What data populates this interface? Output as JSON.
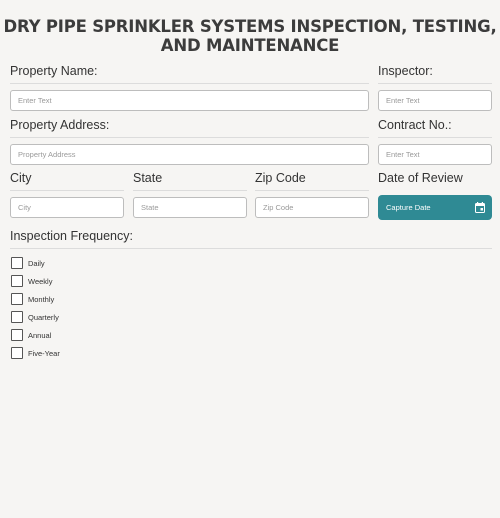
{
  "title": "DRY PIPE SPRINKLER SYSTEMS INSPECTION, TESTING, AND MAINTENANCE",
  "fields": {
    "property_name": {
      "label": "Property Name:",
      "placeholder": "Enter Text"
    },
    "inspector": {
      "label": "Inspector:",
      "placeholder": "Enter Text"
    },
    "property_address": {
      "label": "Property Address:",
      "placeholder": "Property Address"
    },
    "contract_no": {
      "label": "Contract No.:",
      "placeholder": "Enter Text"
    },
    "city": {
      "label": "City",
      "placeholder": "City"
    },
    "state": {
      "label": "State",
      "placeholder": "State"
    },
    "zip": {
      "label": "Zip Code",
      "placeholder": "Zip Code"
    },
    "date_of_review": {
      "label": "Date of Review",
      "button_label": "Capture Date"
    }
  },
  "frequency": {
    "label": "Inspection Frequency:",
    "options": [
      "Daily",
      "Weekly",
      "Monthly",
      "Quarterly",
      "Annual",
      "Five-Year"
    ]
  },
  "colors": {
    "accent": "#2f8a94",
    "background": "#f6f5f3"
  },
  "icons": {
    "date_button": "calendar-icon"
  }
}
